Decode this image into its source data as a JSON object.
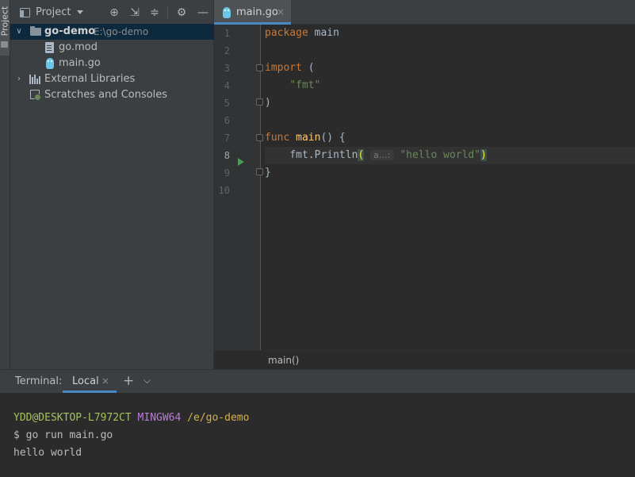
{
  "sidebar_strip": {
    "label": "Project"
  },
  "project_panel": {
    "title": "Project",
    "tree": [
      {
        "label": "go-demo",
        "path": "E:\\go-demo",
        "kind": "folder",
        "expanded": true,
        "selected": true
      },
      {
        "label": "go.mod",
        "kind": "file"
      },
      {
        "label": "main.go",
        "kind": "go-file"
      },
      {
        "label": "External Libraries",
        "kind": "libraries",
        "expanded": false
      },
      {
        "label": "Scratches and Consoles",
        "kind": "scratches"
      }
    ]
  },
  "editor": {
    "tab": {
      "label": "main.go",
      "close": "×"
    },
    "line_numbers": [
      "1",
      "2",
      "3",
      "4",
      "5",
      "6",
      "7",
      "8",
      "9",
      "10"
    ],
    "current_line": 8,
    "code": {
      "l1_kw": "package",
      "l1_name": " main",
      "l3_kw": "import",
      "l3_rest": " (",
      "l4_indent": "    ",
      "l4_str": "\"fmt\"",
      "l5": ")",
      "l7_kw": "func",
      "l7_fn": " main",
      "l7_rest": "() {",
      "l8_indent": "    ",
      "l8_call": "fmt.Println",
      "l8_open": "(",
      "l8_hint": "a…:",
      "l8_space": " ",
      "l8_str": "\"hello world\"",
      "l8_close": ")",
      "l9": "}"
    },
    "breadcrumb": "main()"
  },
  "terminal": {
    "title": "Terminal:",
    "tab_label": "Local",
    "tab_close": "×",
    "add": "+",
    "menu": "⌵",
    "prompt": {
      "user": "YDD@DESKTOP-L7972CT",
      "system": "MINGW64",
      "path": "/e/go-demo"
    },
    "command": "$ go run main.go",
    "output": "hello world"
  },
  "colors": {
    "accent": "#4a88c7",
    "keyword": "#cc7832",
    "string": "#6a8759",
    "function": "#ffc66d",
    "run": "#499c54"
  }
}
